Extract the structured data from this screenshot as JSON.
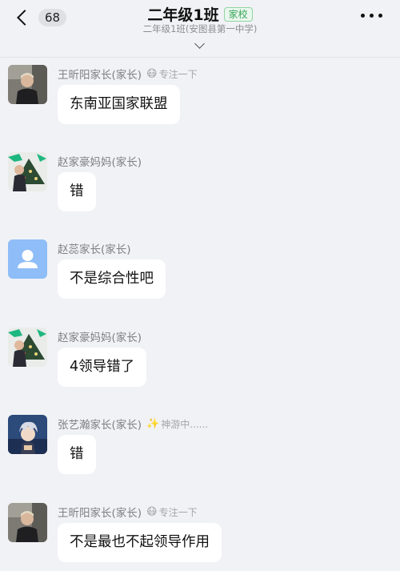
{
  "header": {
    "unread_count": "68",
    "title": "二年级1班",
    "tag": "家校",
    "subtitle": "二年级1班(安图县第一中学)"
  },
  "messages": [
    {
      "sender": "王昕阳家长(家长)",
      "status_emoji": "😷",
      "status_text": "专注一下",
      "text": "东南亚国家联盟",
      "avatar": "photo-man-dark"
    },
    {
      "sender": "赵家豪妈妈(家长)",
      "status_emoji": "",
      "status_text": "",
      "text": "错",
      "avatar": "photo-christmas-girl"
    },
    {
      "sender": "赵蕊家长(家长)",
      "status_emoji": "",
      "status_text": "",
      "text": "不是综合性吧",
      "avatar": "default-person"
    },
    {
      "sender": "赵家豪妈妈(家长)",
      "status_emoji": "",
      "status_text": "",
      "text": "4领导错了",
      "avatar": "photo-christmas-girl"
    },
    {
      "sender": "张艺瀚家长(家长)",
      "status_emoji": "✨",
      "status_text": "神游中......",
      "text": "错",
      "avatar": "anime-boy"
    },
    {
      "sender": "王昕阳家长(家长)",
      "status_emoji": "😷",
      "status_text": "专注一下",
      "text": "不是最也不起领导作用",
      "avatar": "photo-man-dark"
    }
  ],
  "colors": {
    "background": "#f1f2f5",
    "bubble": "#ffffff",
    "tag_green": "#3aa55a",
    "default_avatar": "#8fbdf7"
  }
}
